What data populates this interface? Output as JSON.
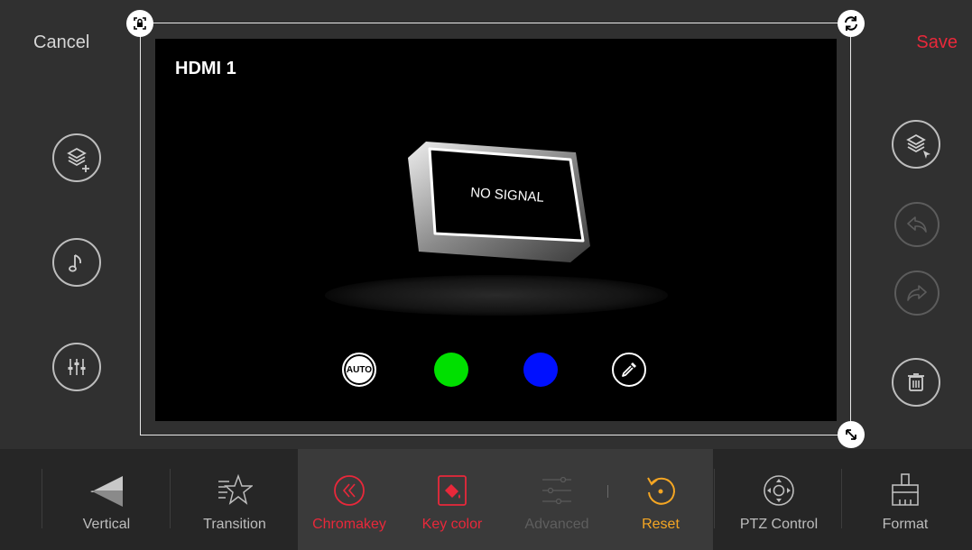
{
  "header": {
    "cancel_label": "Cancel",
    "save_label": "Save"
  },
  "preview": {
    "source_label": "HDMI 1",
    "no_signal_text": "NO SIGNAL",
    "auto_label": "AUTO"
  },
  "left_tools": [
    "add-layer-icon",
    "music-note-icon",
    "mixer-sliders-icon"
  ],
  "right_tools": [
    "select-layer-icon",
    "undo-icon",
    "redo-icon",
    "trash-icon"
  ],
  "toolbar": {
    "vertical": "Vertical",
    "transition": "Transition",
    "chromakey": "Chromakey",
    "key_color": "Key color",
    "advanced": "Advanced",
    "reset": "Reset",
    "ptz_control": "PTZ Control",
    "format": "Format"
  },
  "colors": {
    "accent_red": "#e8283a",
    "reset_orange": "#f5a623",
    "green_key": "#00e000",
    "blue_key": "#0010ff"
  }
}
